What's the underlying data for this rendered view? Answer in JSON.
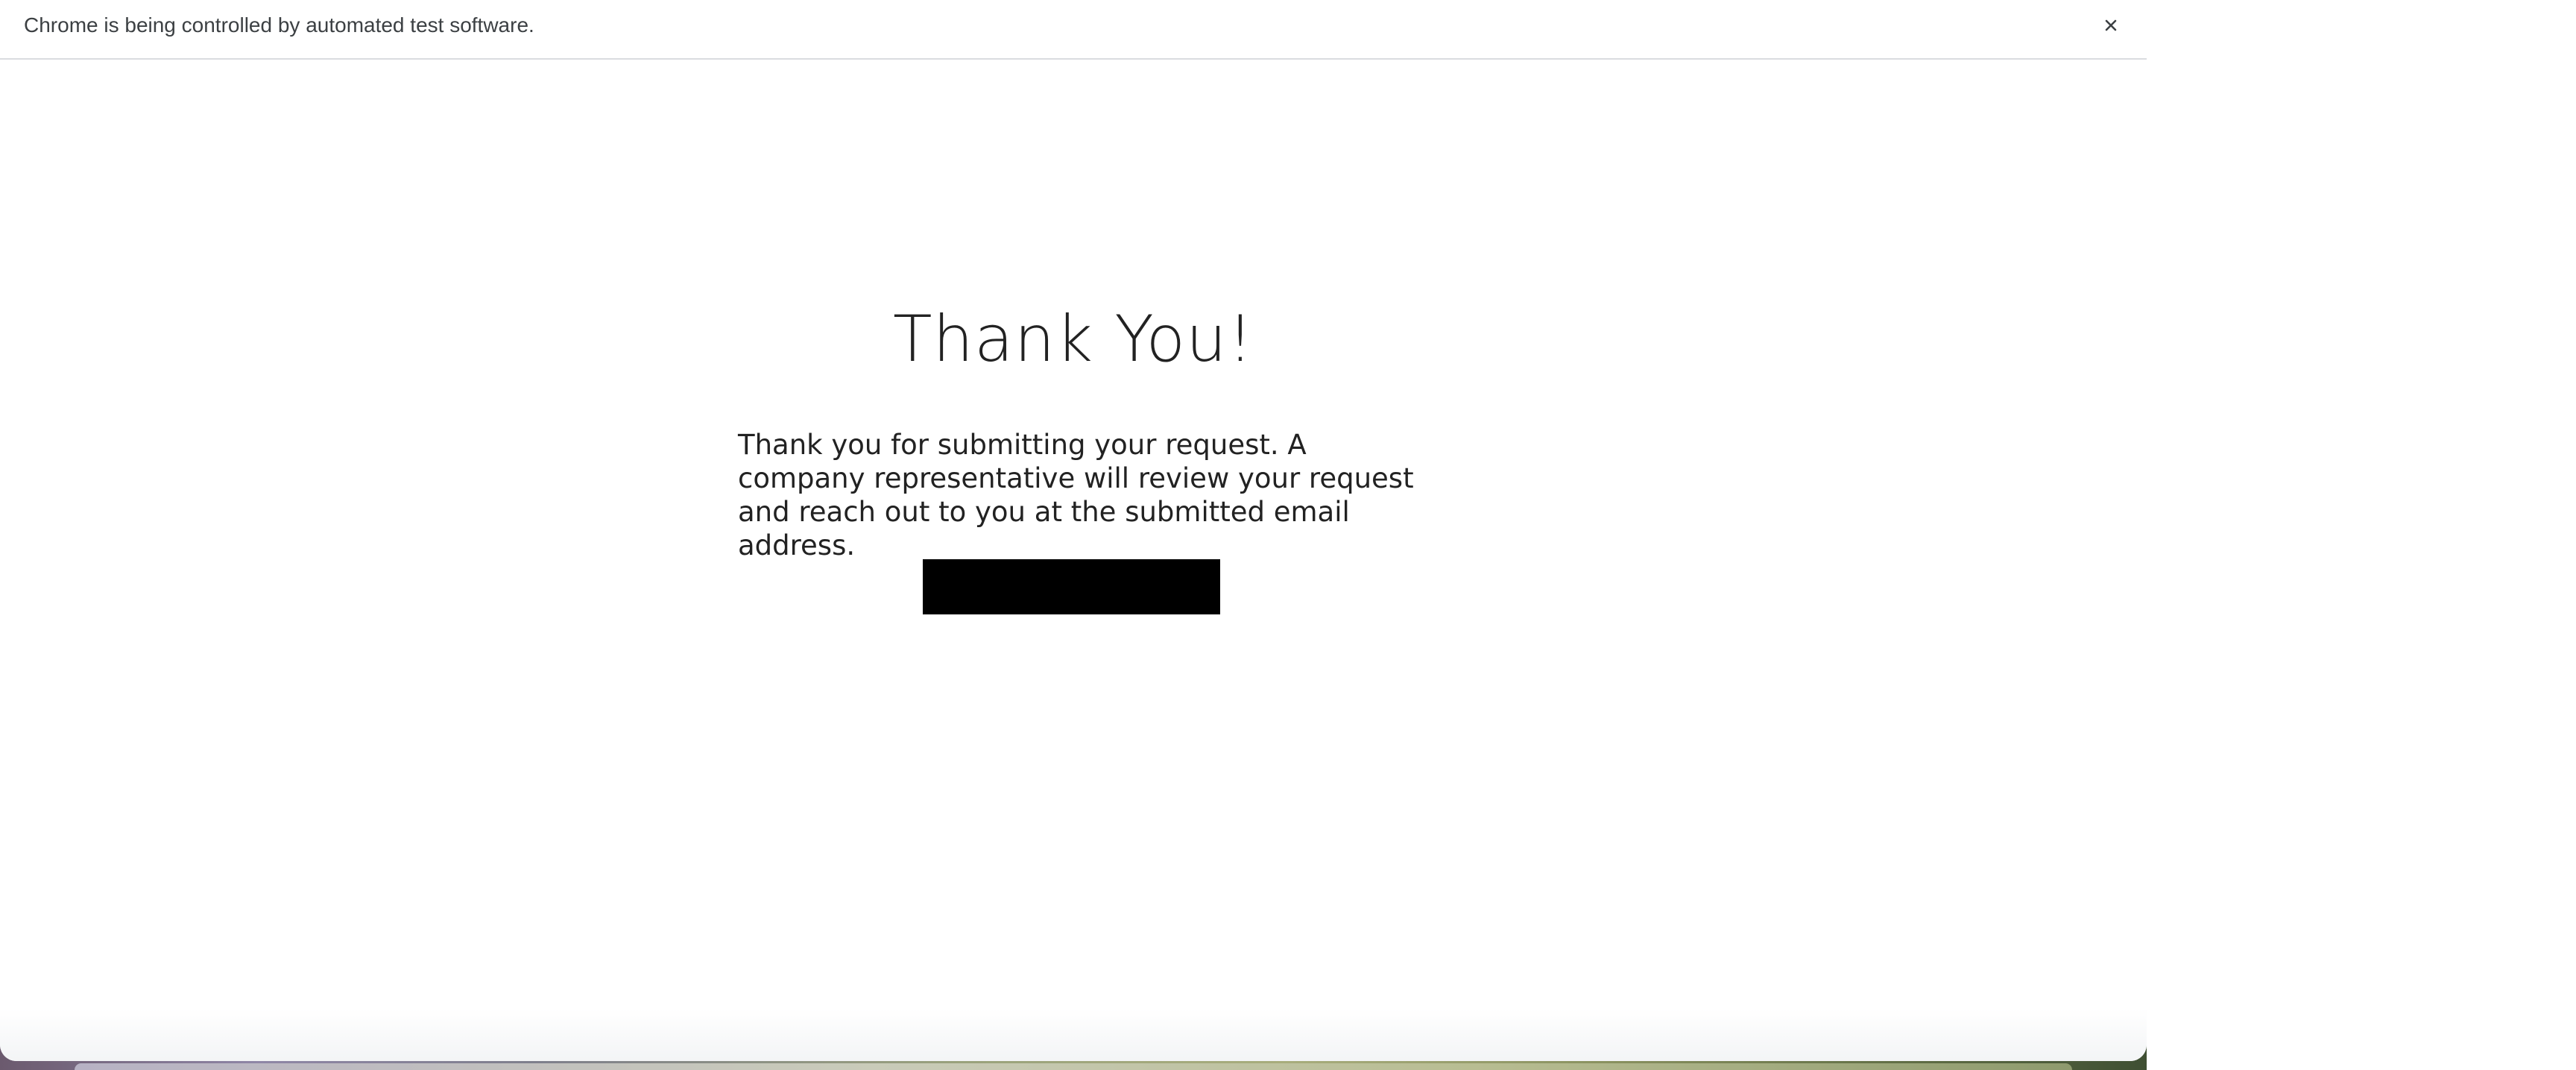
{
  "automation_bar": {
    "message": "Chrome is being controlled by automated test software.",
    "close_icon": "close-icon"
  },
  "page": {
    "heading": "Thank You!",
    "message": "Thank you for submitting your request. A company representative will review your request and reach out to you at the submitted email address.",
    "button_label": ""
  },
  "colors": {
    "background": "#ffffff",
    "text": "#222222",
    "button": "#000000",
    "infobar_text": "#3c4043"
  }
}
